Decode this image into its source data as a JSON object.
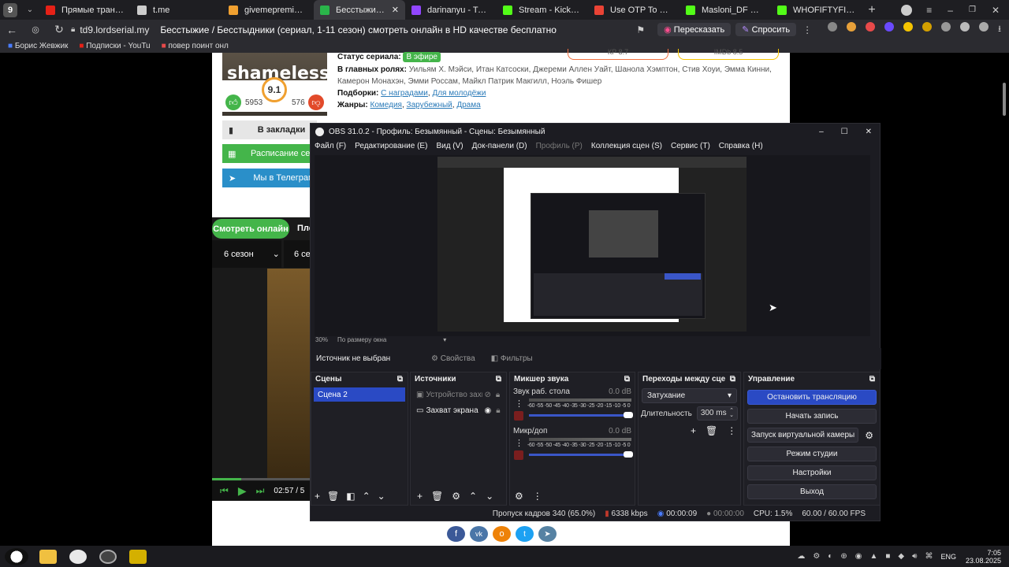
{
  "browser": {
    "tab_count_badge": "9",
    "tabs": [
      {
        "label": "Прямые трансляции",
        "color": "#e62117"
      },
      {
        "label": "t.me",
        "color": "#cccccc"
      },
      {
        "label": "givemepremium — cr",
        "color": "#f0a030"
      },
      {
        "label": "Бесстыжие / Бесс",
        "color": "#2ab54a"
      },
      {
        "label": "darinanyu - Twitch",
        "color": "#9146ff"
      },
      {
        "label": "Stream - Kick Dashbo",
        "color": "#53fc18"
      },
      {
        "label": "Use OTP To Proceed",
        "color": "#ea4335"
      },
      {
        "label": "Masloni_DF Stream -",
        "color": "#53fc18"
      },
      {
        "label": "WHOFIFTYFIVE Strea",
        "color": "#53fc18"
      }
    ],
    "url": "td9.lordserial.my",
    "page_title": "Бесстыжие / Бесстыдники (сериал, 1-11 сезон) смотреть онлайн в HD качестве бесплатно",
    "retell_label": "Пересказать",
    "ask_label": "Спросить",
    "bookmarks": [
      "Борис Жевжик",
      "Подписки - YouTu",
      "повер поинт онл"
    ]
  },
  "page": {
    "poster_text": "shameless",
    "rating": "9.1",
    "likes": "5953",
    "dislikes": "576",
    "kp_label": "КР 8.7",
    "imdb_label": "IMDb 8.5",
    "status_label": "Статус сериала:",
    "status_value": "В эфире",
    "cast_label": "В главных ролях:",
    "cast_value": "Уильям Х. Мэйси, Итан Катсоски, Джереми Аллен Уайт, Шанола Хэмптон, Стив Хоуи, Эмма Кинни, Камерон Монахэн, Эмми Россам, Майкл Патрик Макгилл, Ноэль Фишер",
    "collections_label": "Подборки:",
    "collections": [
      "С наградами",
      "Для молодёжи"
    ],
    "genres_label": "Жанры:",
    "genres": [
      "Комедия",
      "Зарубежный",
      "Драма"
    ],
    "bookmark_btn": "В закладки",
    "schedule_btn": "Расписание сери",
    "telegram_btn": "Мы в Телеграм",
    "watch_btn": "Смотреть онлайн",
    "player_btn": "Пле",
    "season_select": "6 сезон",
    "series_select": "6 сер",
    "player_time": "02:57 / 5",
    "progress": 0.3
  },
  "obs": {
    "title": "OBS 31.0.2 - Профиль: Безымянный - Сцены: Безымянный",
    "menu": [
      "Файл (F)",
      "Редактирование (E)",
      "Вид (V)",
      "Док-панели (D)",
      "Профиль (P)",
      "Коллекция сцен (S)",
      "Сервис (T)",
      "Справка (H)"
    ],
    "zoom": "30%",
    "zoom_mode": "По размеру окна",
    "no_source": "Источник не выбран",
    "properties": "Свойства",
    "filters": "Фильтры",
    "scenes_title": "Сцены",
    "scenes": [
      "Сцена 2"
    ],
    "sources_title": "Источники",
    "sources": [
      "Устройство захв",
      "Захват экрана"
    ],
    "mixer_title": "Микшер звука",
    "channels": [
      {
        "name": "Звук раб. стола",
        "db": "0.0 dB"
      },
      {
        "name": "Микр/доп",
        "db": "0.0 dB"
      }
    ],
    "meter_scale": "-60 -55 -50 -45 -40 -35 -30 -25 -20 -15 -10 -5 0",
    "transitions_title": "Переходы между сце...",
    "transition": "Затухание",
    "duration_label": "Длительность",
    "duration_value": "300 ms",
    "controls_title": "Управление",
    "stop_stream": "Остановить трансляцию",
    "start_record": "Начать запись",
    "virtual_cam": "Запуск виртуальной камеры",
    "studio_mode": "Режим студии",
    "settings": "Настройки",
    "exit": "Выход",
    "status": {
      "dropped": "Пропуск кадров 340 (65.0%)",
      "bitrate": "6338 kbps",
      "stream_time": "00:00:09",
      "record_time": "00:00:00",
      "cpu": "CPU: 1.5%",
      "fps": "60.00 / 60.00 FPS"
    }
  },
  "taskbar": {
    "lang": "ENG",
    "time": "7:05",
    "date": "23.08.2025"
  }
}
